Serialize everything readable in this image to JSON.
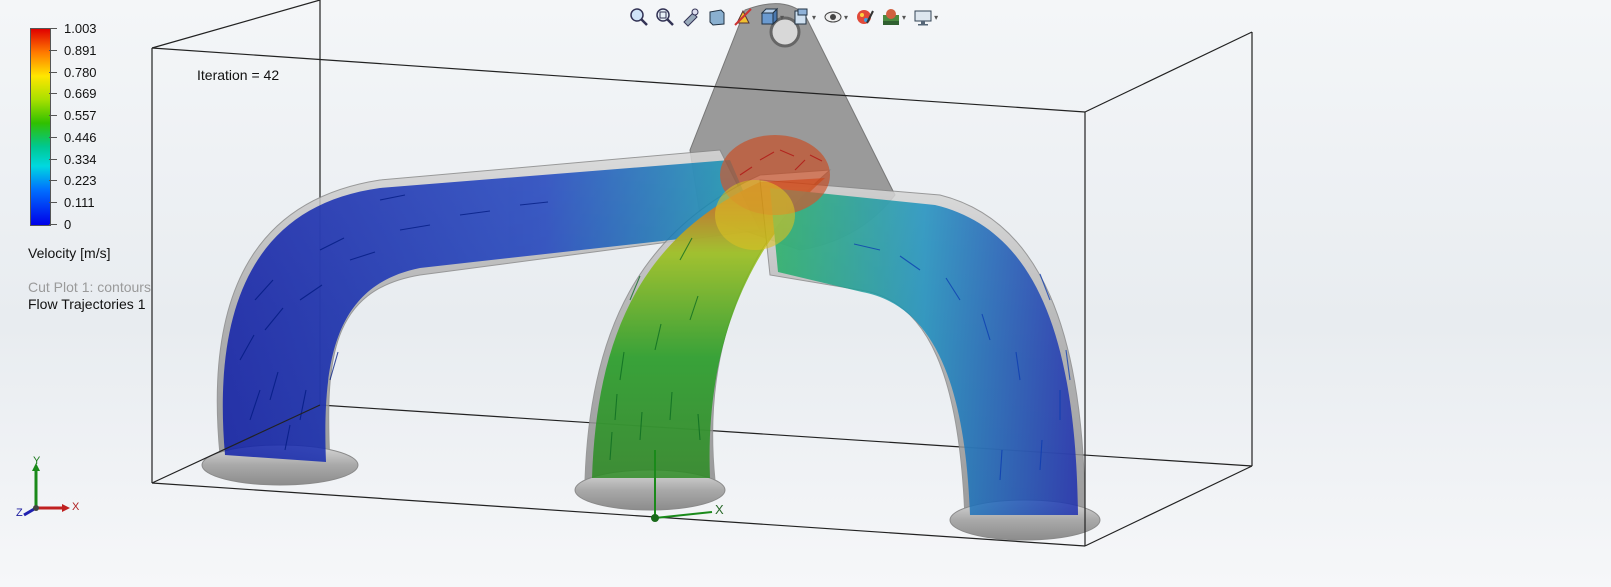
{
  "toolbar": {
    "icons": [
      "zoom-to-fit-icon",
      "zoom-to-area-icon",
      "previous-view-icon",
      "section-view-icon",
      "dynamic-annotation-icon",
      "view-orientation-icon",
      "display-style-icon",
      "hide-show-items-icon",
      "edit-appearance-icon",
      "apply-scene-icon",
      "view-settings-icon"
    ]
  },
  "legend": {
    "ticks": [
      "1.003",
      "0.891",
      "0.780",
      "0.669",
      "0.557",
      "0.446",
      "0.334",
      "0.223",
      "0.111",
      "0"
    ],
    "title": "Velocity [m/s]",
    "colors": [
      "#e00000",
      "#ff7a00",
      "#ffe600",
      "#a8e000",
      "#30c000",
      "#00c890",
      "#00d8e0",
      "#0070ff",
      "#0000e8"
    ]
  },
  "plots": {
    "cut_plot": "Cut Plot 1: contours",
    "flow_trajectories": "Flow Trajectories 1"
  },
  "iteration": "Iteration = 42",
  "triad": {
    "y": "Y",
    "x": "X",
    "z": "Z"
  },
  "origin_axes": {
    "x": "X"
  }
}
